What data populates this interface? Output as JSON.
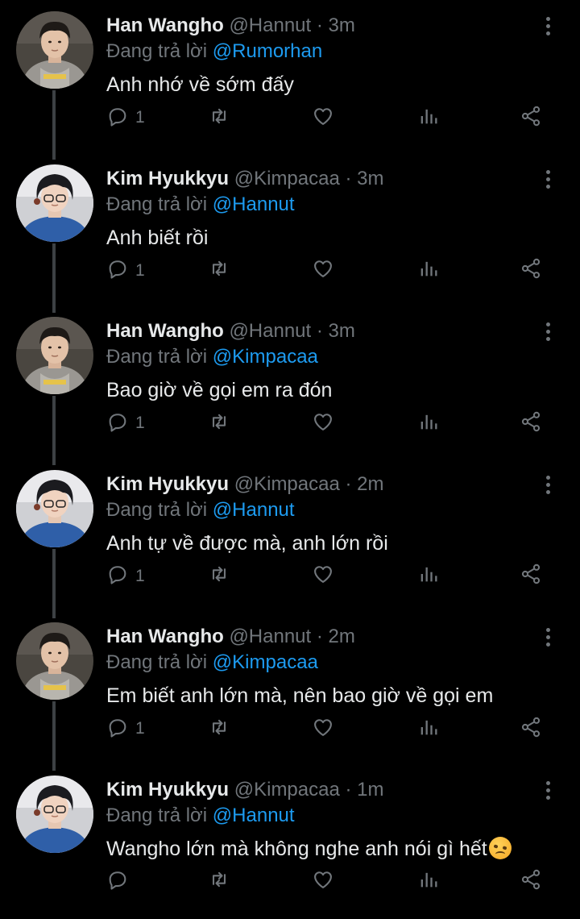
{
  "tweets": [
    {
      "name": "Han Wangho",
      "handle": "@Hannut",
      "sep": "·",
      "time": "3m",
      "reply_prefix": "Đang trả lời",
      "reply_to": "@Rumorhan",
      "text": "Anh nhớ về sớm đấy",
      "reply_count": "1",
      "avatar": "hannut"
    },
    {
      "name": "Kim Hyukkyu",
      "handle": "@Kimpacaa",
      "sep": "·",
      "time": "3m",
      "reply_prefix": "Đang trả lời",
      "reply_to": "@Hannut",
      "text": "Anh biết rồi",
      "reply_count": "1",
      "avatar": "kimpacaa"
    },
    {
      "name": "Han Wangho",
      "handle": "@Hannut",
      "sep": "·",
      "time": "3m",
      "reply_prefix": "Đang trả lời",
      "reply_to": "@Kimpacaa",
      "text": "Bao giờ về gọi em ra đón",
      "reply_count": "1",
      "avatar": "hannut"
    },
    {
      "name": "Kim Hyukkyu",
      "handle": "@Kimpacaa",
      "sep": "·",
      "time": "2m",
      "reply_prefix": "Đang trả lời",
      "reply_to": "@Hannut",
      "text": "Anh tự về được mà, anh lớn rồi",
      "reply_count": "1",
      "avatar": "kimpacaa"
    },
    {
      "name": "Han Wangho",
      "handle": "@Hannut",
      "sep": "·",
      "time": "2m",
      "reply_prefix": "Đang trả lời",
      "reply_to": "@Kimpacaa",
      "text": "Em biết anh lớn mà, nên bao giờ về gọi em",
      "reply_count": "1",
      "avatar": "hannut"
    },
    {
      "name": "Kim Hyukkyu",
      "handle": "@Kimpacaa",
      "sep": "·",
      "time": "1m",
      "reply_prefix": "Đang trả lời",
      "reply_to": "@Hannut",
      "text": "Wangho lớn mà không nghe anh nói gì hết",
      "reply_count": "",
      "avatar": "kimpacaa",
      "emoji": "pouting-face-emoji"
    }
  ],
  "colors": {
    "background": "#000000",
    "text": "#e7e9ea",
    "muted": "#71767b",
    "accent": "#1d9bf0",
    "thread_line": "#3d4144"
  },
  "icons": {
    "reply": "reply-icon",
    "retweet": "retweet-icon",
    "like": "heart-icon",
    "views": "views-icon",
    "share": "share-icon",
    "menu": "more-icon"
  }
}
